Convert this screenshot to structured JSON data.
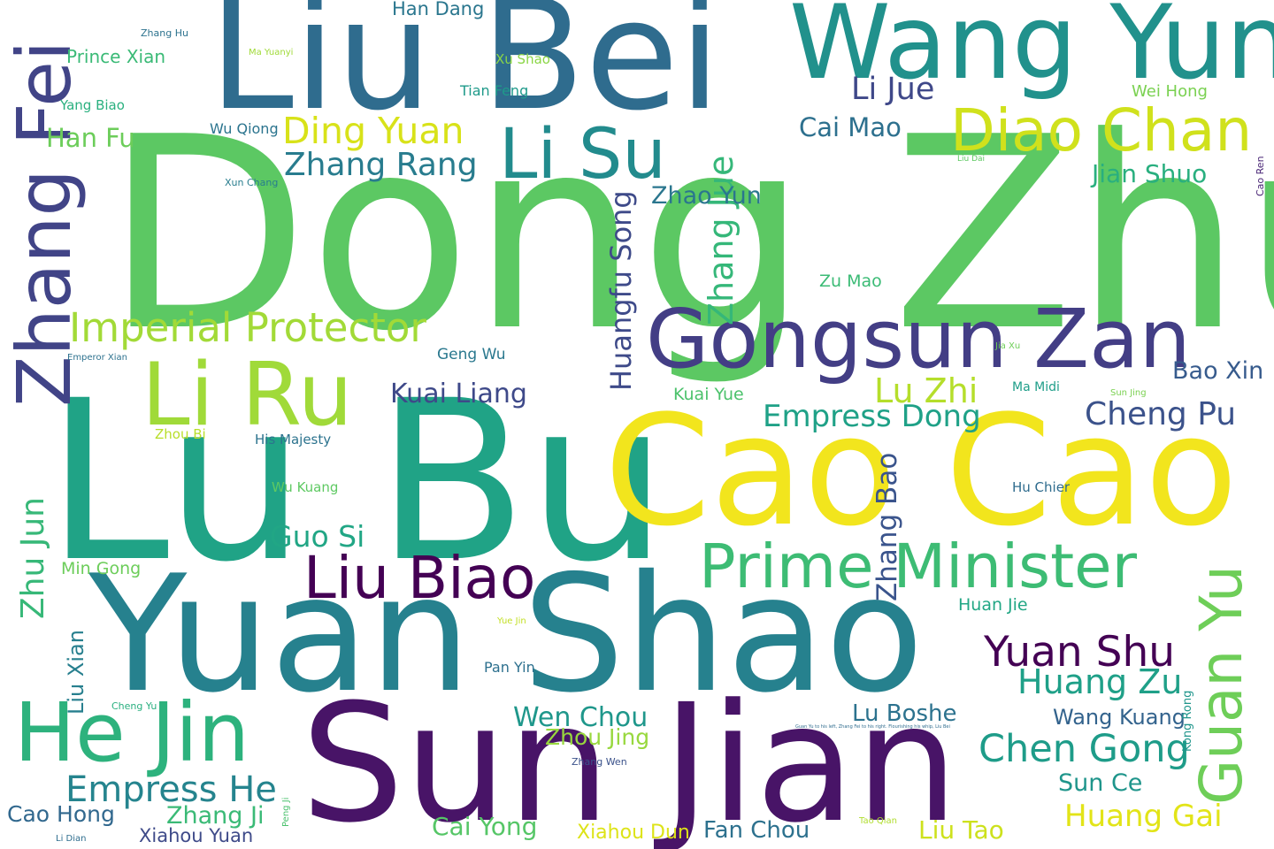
{
  "words": [
    {
      "text": "Dong Zhuo",
      "color": "#5cc863"
    },
    {
      "text": "Lu Bu",
      "color": "#20a386"
    },
    {
      "text": "Cao Cao",
      "color": "#f2e51d"
    },
    {
      "text": "Yuan Shao",
      "color": "#26818e"
    },
    {
      "text": "Sun Jian",
      "color": "#481467"
    },
    {
      "text": "Liu Bei",
      "color": "#2f6c8e"
    },
    {
      "text": "Wang Yun",
      "color": "#21918c"
    },
    {
      "text": "Gongsun Zan",
      "color": "#433e85"
    },
    {
      "text": "Li Ru",
      "color": "#a0da39"
    },
    {
      "text": "He Jin",
      "color": "#2db27d"
    },
    {
      "text": "Zhang Fei",
      "color": "#414487"
    },
    {
      "text": "Prime Minister",
      "color": "#3dbc74"
    },
    {
      "text": "Diao Chan",
      "color": "#d0e11c"
    },
    {
      "text": "Li Su",
      "color": "#228b8d"
    },
    {
      "text": "Liu Biao",
      "color": "#440154"
    },
    {
      "text": "Guan Yu",
      "color": "#6ece58"
    },
    {
      "text": "Imperial Protector",
      "color": "#a2da37"
    },
    {
      "text": "Yuan Shu",
      "color": "#440154"
    },
    {
      "text": "Chen Gong",
      "color": "#1e9c89"
    },
    {
      "text": "Empress He",
      "color": "#25848e"
    },
    {
      "text": "Ding Yuan",
      "color": "#d8e219"
    },
    {
      "text": "Zhang Rang",
      "color": "#287c8e"
    },
    {
      "text": "Huang Zu",
      "color": "#1fa088"
    },
    {
      "text": "Zhang Jue",
      "color": "#35b779"
    },
    {
      "text": "Huangfu Song",
      "color": "#3e4a89"
    },
    {
      "text": "Empress Dong",
      "color": "#1fa187"
    },
    {
      "text": "Cheng Pu",
      "color": "#3b528b"
    },
    {
      "text": "Lu Zhi",
      "color": "#b5de2b"
    },
    {
      "text": "Li Jue",
      "color": "#3f4889"
    },
    {
      "text": "Zhu Jun",
      "color": "#37b878"
    },
    {
      "text": "Zhu Jun",
      "color": "#37b878"
    },
    {
      "text": "Zhang Bao",
      "color": "#3a548c"
    },
    {
      "text": "Kuai Liang",
      "color": "#3e4989"
    },
    {
      "text": "Bao Xin",
      "color": "#375b8d"
    },
    {
      "text": "Huang Gai",
      "color": "#e2e418"
    },
    {
      "text": "Wen Chou",
      "color": "#1f978b"
    },
    {
      "text": "Han Fu",
      "color": "#6ccd5a"
    },
    {
      "text": "Cai Mao",
      "color": "#2d708e"
    },
    {
      "text": "Jian Shuo",
      "color": "#29af7f"
    },
    {
      "text": "Zhao Yun",
      "color": "#2a768e"
    },
    {
      "text": "Guo Si",
      "color": "#21a685"
    },
    {
      "text": "Cai Yong",
      "color": "#56c667"
    },
    {
      "text": "Liu Tao",
      "color": "#cde11d"
    },
    {
      "text": "Sun Ce",
      "color": "#1f958b"
    },
    {
      "text": "Fan Chou",
      "color": "#2d718e"
    },
    {
      "text": "Zhang Ji",
      "color": "#3aba76"
    },
    {
      "text": "Xiahou Dun",
      "color": "#dde318"
    },
    {
      "text": "Cao Hong",
      "color": "#31688e"
    },
    {
      "text": "Xiahou Yuan",
      "color": "#3e4a89"
    },
    {
      "text": "Zhou Jing",
      "color": "#98d83e"
    },
    {
      "text": "Lu Boshe",
      "color": "#2c728e"
    },
    {
      "text": "Wang Kuang",
      "color": "#33638d"
    },
    {
      "text": "Liu Xian",
      "color": "#277f8e"
    },
    {
      "text": "Han Dang",
      "color": "#2a768e"
    },
    {
      "text": "Prince Xian",
      "color": "#3aba76"
    },
    {
      "text": "Zu Mao",
      "color": "#3bbb75"
    },
    {
      "text": "Kuai Yue",
      "color": "#4cc26c"
    },
    {
      "text": "Wu Qiong",
      "color": "#2b748e"
    },
    {
      "text": "Geng Wu",
      "color": "#2a788e"
    },
    {
      "text": "Wei Hong",
      "color": "#7ad151"
    },
    {
      "text": "Huan Jie",
      "color": "#22a785"
    },
    {
      "text": "Min Gong",
      "color": "#6ccd5a"
    },
    {
      "text": "Pan Yin",
      "color": "#2d708e"
    },
    {
      "text": "Tian Feng",
      "color": "#1f9a8a"
    },
    {
      "text": "Xu Shao",
      "color": "#8bd646"
    },
    {
      "text": "Yang Biao",
      "color": "#2ab07f"
    },
    {
      "text": "His Majesty",
      "color": "#2c738e"
    },
    {
      "text": "Zhou Bi",
      "color": "#b8de29"
    },
    {
      "text": "Wu Kuang",
      "color": "#5ec962"
    },
    {
      "text": "Hu Chier",
      "color": "#2f6c8e"
    },
    {
      "text": "Ma Midi",
      "color": "#1f9e89"
    },
    {
      "text": "Kong Rong",
      "color": "#1f958b"
    },
    {
      "text": "Zhang Wen",
      "color": "#3b528b"
    },
    {
      "text": "Cheng Yu",
      "color": "#29af7f"
    },
    {
      "text": "Xun Chang",
      "color": "#287d8e"
    },
    {
      "text": "Zhang Hu",
      "color": "#2c728e"
    },
    {
      "text": "Ma Yuanyi",
      "color": "#a0da39"
    },
    {
      "text": "Emperor Xian",
      "color": "#2d718e"
    },
    {
      "text": "Jia Xu",
      "color": "#6ece58"
    },
    {
      "text": "Sun Jing",
      "color": "#7ad151"
    },
    {
      "text": "Yue Jin",
      "color": "#c2df23"
    },
    {
      "text": "Liu Dai",
      "color": "#5ec962"
    },
    {
      "text": "Cao Ren",
      "color": "#482475"
    },
    {
      "text": "Li Dian",
      "color": "#2e6d8e"
    },
    {
      "text": "Peng Ji",
      "color": "#4ac16d"
    },
    {
      "text": "Tao Qian",
      "color": "#b0dd2f"
    },
    {
      "text": "Guan Yu to his left, Zhang Fei to his right. Flourishing his whip, Liu Bei",
      "color": "#2f6c8e"
    }
  ]
}
